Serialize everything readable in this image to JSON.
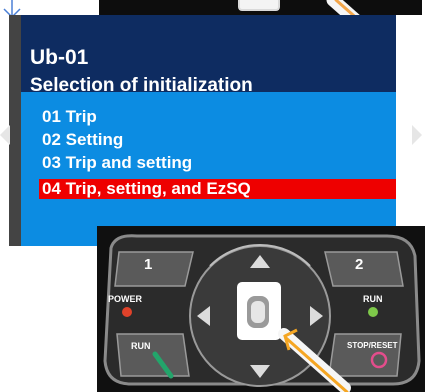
{
  "display": {
    "code": "Ub-01",
    "title": "Selection of initialization",
    "options": [
      {
        "label": "01 Trip",
        "selected": false
      },
      {
        "label": "02 Setting",
        "selected": false
      },
      {
        "label": "03 Trip and setting",
        "selected": false
      },
      {
        "label": "04 Trip, setting, and EzSQ",
        "selected": true
      }
    ]
  },
  "keypad": {
    "key1": "1",
    "key2": "2",
    "power_label": "POWER",
    "run_led_label": "RUN",
    "run_key_label": "RUN",
    "stop_key_label": "STOP/RESET"
  },
  "icons": {
    "marker": "down-arrow-icon",
    "nav_left": "triangle-left-icon",
    "nav_right": "triangle-right-icon",
    "pointer": "pointer-arrow-icon"
  },
  "colors": {
    "header": "#0e2c61",
    "body": "#0c8ce2",
    "selected": "#ee0000",
    "pointer": "#f5a623"
  }
}
